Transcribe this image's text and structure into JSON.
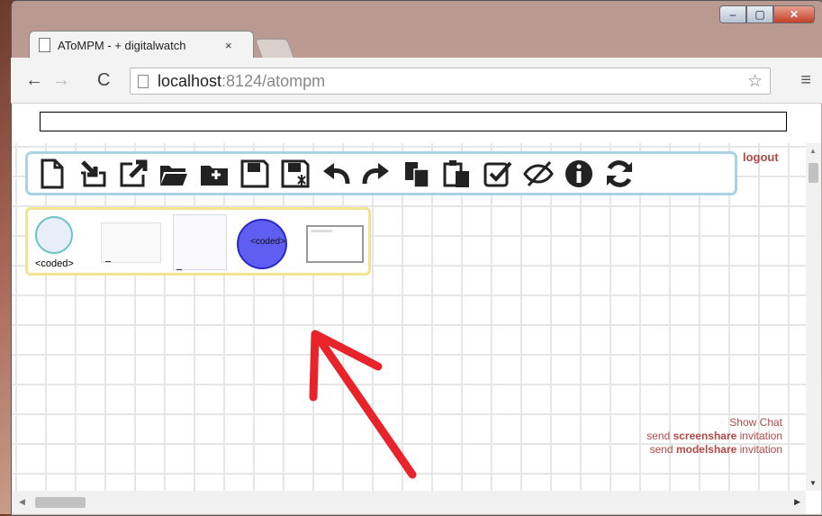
{
  "browser": {
    "tab_title": "AToMPM - + digitalwatch",
    "tab_close": "×",
    "url_host": "localhost",
    "url_rest": ":8124/atompm",
    "star": "☆",
    "menu": "≡"
  },
  "app": {
    "logout_label": "logout",
    "toolbar_icons": [
      "new-file-icon",
      "import-icon",
      "export-icon",
      "open-folder-icon",
      "new-folder-icon",
      "save-icon",
      "save-as-icon",
      "undo-icon",
      "redo-icon",
      "copy-icon",
      "paste-icon",
      "validate-icon",
      "hide-icon",
      "info-icon",
      "refresh-icon"
    ],
    "palette": {
      "circle_label": "<coded>",
      "blue_label": "<coded>"
    },
    "chat": {
      "show_chat": "Show Chat",
      "screenshare_pre": "send ",
      "screenshare_bold": "screenshare",
      "screenshare_post": " invitation",
      "modelshare_pre": "send ",
      "modelshare_bold": "modelshare",
      "modelshare_post": " invitation"
    },
    "colors": {
      "toolbar_border": "#a9d2e6",
      "palette_border": "#f0e48e",
      "link": "#b34848",
      "arrow": "#e8232a"
    }
  }
}
